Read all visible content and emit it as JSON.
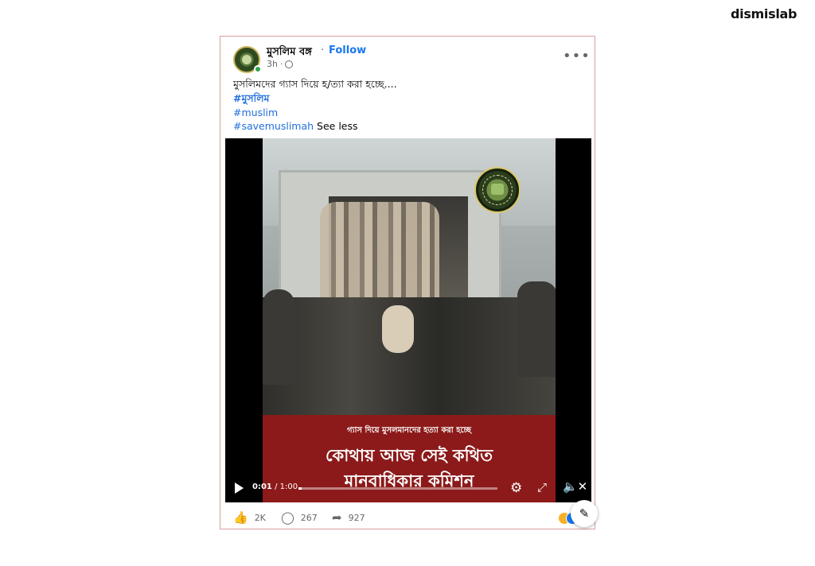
{
  "brand": "dismislab",
  "post": {
    "page_name": "মুসলিম বঙ্গ",
    "follow_label": "Follow",
    "time": "3h",
    "caption": "মুসলিমদের গ্যাস দিয়ে হ/ত্যা করা হচ্ছে....",
    "hashtags": [
      "#মুসলিম",
      "#muslim",
      "#savemuslimah"
    ],
    "see_less_label": "See less"
  },
  "video": {
    "overlay_small": "গ্যাস দিয়ে মুসলমানদের হত্যা করা হচ্ছে",
    "overlay_line1": "কোথায় আজ সেই কথিত",
    "overlay_line2": "মানবাধিকার কমিশন",
    "current_time": "0:01",
    "duration": "1:00",
    "progress_fraction": 0.017
  },
  "actions": {
    "likes": "2K",
    "comments": "267",
    "shares": "927"
  },
  "icons": {
    "more": "more-options-icon",
    "like": "thumbs-up-icon",
    "comment": "comment-icon",
    "share": "share-icon",
    "settings": "gear-icon",
    "expand": "expand-icon",
    "mute": "mute-icon",
    "edit": "edit-icon"
  },
  "colors": {
    "link": "#1877f2",
    "hashtag": "#216fdb",
    "banner": "#8c1a1a",
    "border": "#d9a0a0"
  }
}
